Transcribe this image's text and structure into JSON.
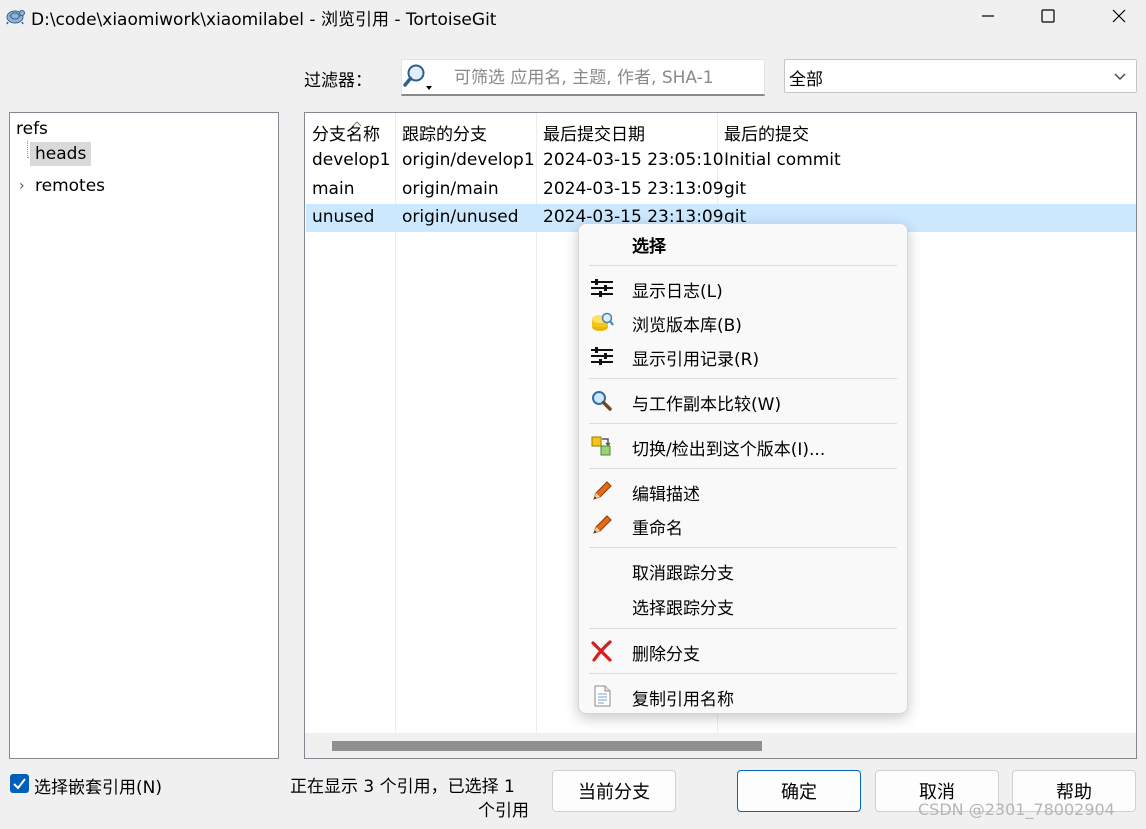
{
  "window": {
    "title": "D:\\code\\xiaomiwork\\xiaomilabel - 浏览引用 - TortoiseGit",
    "app_icon": "tortoise-icon",
    "controls": [
      "minimize-icon",
      "maximize-icon",
      "close-icon"
    ]
  },
  "filter": {
    "label": "过滤器：",
    "placeholder": "可筛选 应用名, 主题, 作者, SHA-1",
    "value": "",
    "scope": "全部"
  },
  "tree": {
    "root": "refs",
    "children": [
      {
        "label": "heads",
        "selected": true
      },
      {
        "label": "remotes",
        "expandable": true
      }
    ]
  },
  "list": {
    "columns": [
      "分支名称",
      "跟踪的分支",
      "最后提交日期",
      "最后的提交"
    ],
    "rows": [
      {
        "name": "develop1",
        "tracked": "origin/develop1",
        "date": "2024-03-15 23:05:10",
        "commit": "Initial commit"
      },
      {
        "name": "main",
        "tracked": "origin/main",
        "date": "2024-03-15 23:13:09",
        "commit": "git"
      },
      {
        "name": "unused",
        "tracked": "origin/unused",
        "date": "2024-03-15 23:13:09",
        "commit": "git",
        "selected": true
      }
    ]
  },
  "context_menu": {
    "items": [
      {
        "label": "选择",
        "icon": ""
      },
      {
        "label": "显示日志(L)",
        "icon": "log-icon"
      },
      {
        "label": "浏览版本库(B)",
        "icon": "repo-browser-icon"
      },
      {
        "label": "显示引用记录(R)",
        "icon": "reflog-icon"
      },
      {
        "label": "与工作副本比较(W)",
        "icon": "magnifier-icon"
      },
      {
        "label": "切换/检出到这个版本(I)...",
        "icon": "switch-icon"
      },
      {
        "label": "编辑描述",
        "icon": "pencil-icon"
      },
      {
        "label": "重命名",
        "icon": "pencil-icon"
      },
      {
        "label": "取消跟踪分支",
        "icon": ""
      },
      {
        "label": "选择跟踪分支",
        "icon": ""
      },
      {
        "label": "删除分支",
        "icon": "delete-icon"
      },
      {
        "label": "复制引用名称",
        "icon": "copy-icon"
      }
    ]
  },
  "footer": {
    "nested_refs_label": "选择嵌套引用(N)",
    "nested_refs_checked": true,
    "status_line1": "正在显示 3 个引用，已选择 1",
    "status_line2": "个引用",
    "buttons": {
      "current_branch": "当前分支",
      "ok": "确定",
      "cancel": "取消",
      "help": "帮助"
    }
  },
  "watermark": "CSDN @2301_78002904",
  "colors": {
    "selection": "#cce8ff",
    "accent": "#0067c0",
    "checkbox": "#005fb8"
  }
}
